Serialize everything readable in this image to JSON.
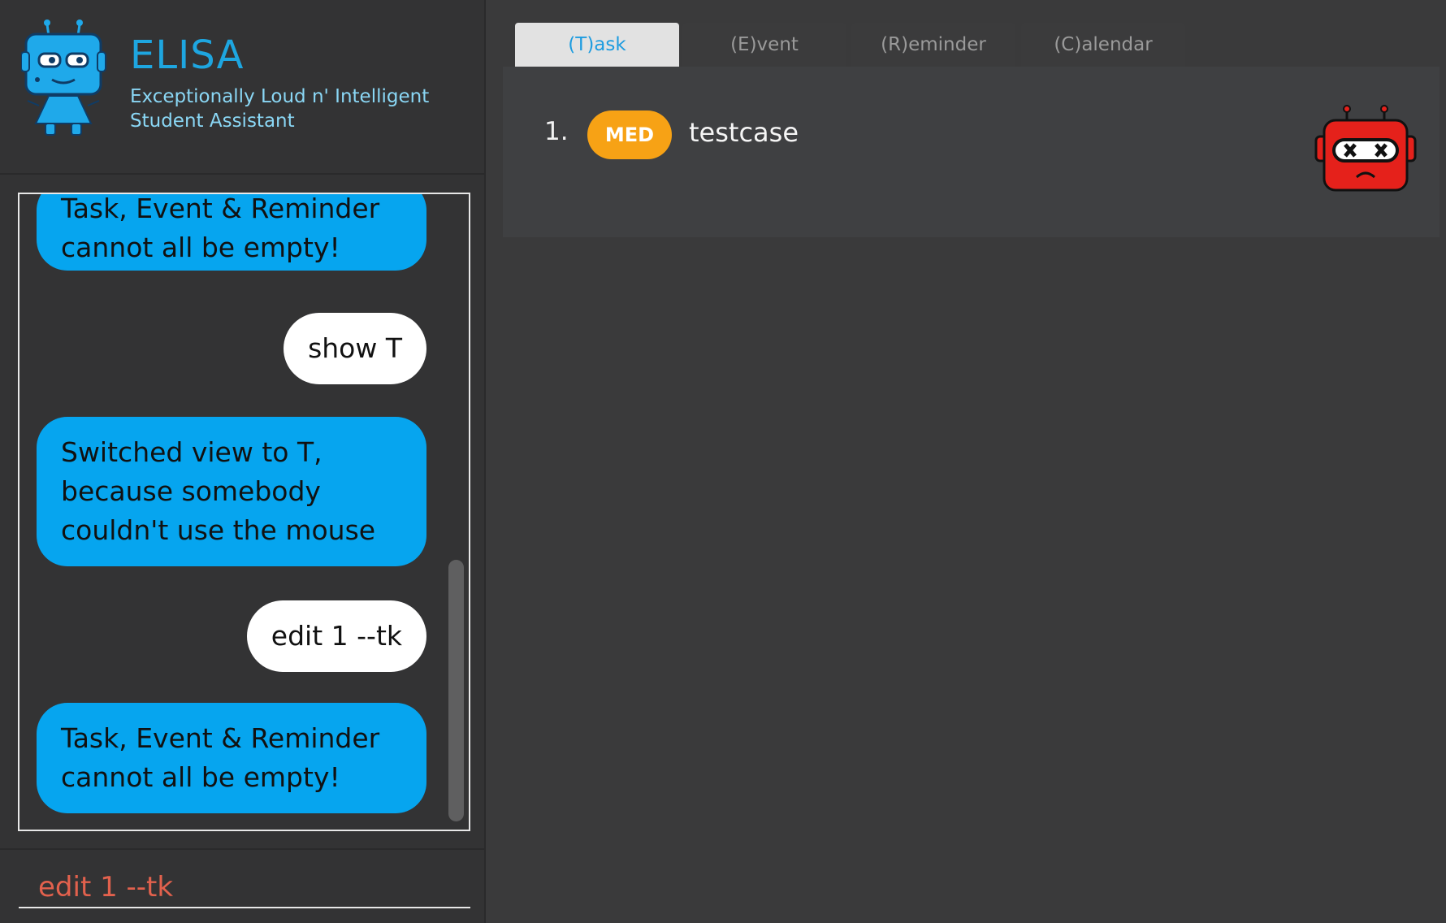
{
  "app": {
    "title": "ELISA",
    "subtitle": "Exceptionally Loud n' Intelligent Student Assistant"
  },
  "chat": {
    "messages": [
      {
        "sender": "bot",
        "text": "Task, Event & Reminder cannot all be empty!"
      },
      {
        "sender": "user",
        "text": "show T"
      },
      {
        "sender": "bot",
        "text": "Switched view to T, because somebody couldn't use the mouse"
      },
      {
        "sender": "user",
        "text": "edit 1 --tk"
      },
      {
        "sender": "bot",
        "text": "Task, Event & Reminder cannot all be empty!"
      }
    ]
  },
  "command": {
    "value": "edit 1 --tk"
  },
  "tabs": [
    {
      "label": "(T)ask",
      "active": true
    },
    {
      "label": "(E)vent",
      "active": false
    },
    {
      "label": "(R)eminder",
      "active": false
    },
    {
      "label": "(C)alendar",
      "active": false
    }
  ],
  "task_list": [
    {
      "index": "1.",
      "priority": "MED",
      "description": "testcase"
    }
  ],
  "colors": {
    "bot_bubble": "#06a5ef",
    "user_bubble": "#ffffff",
    "priority_med": "#f7a215",
    "accent": "#1ea6e0",
    "command_text": "#e2614d",
    "mascot_red": "#e5211b"
  },
  "icons": {
    "logo": "elisa-robot-blue-icon",
    "mascot": "robot-dead-red-icon"
  }
}
